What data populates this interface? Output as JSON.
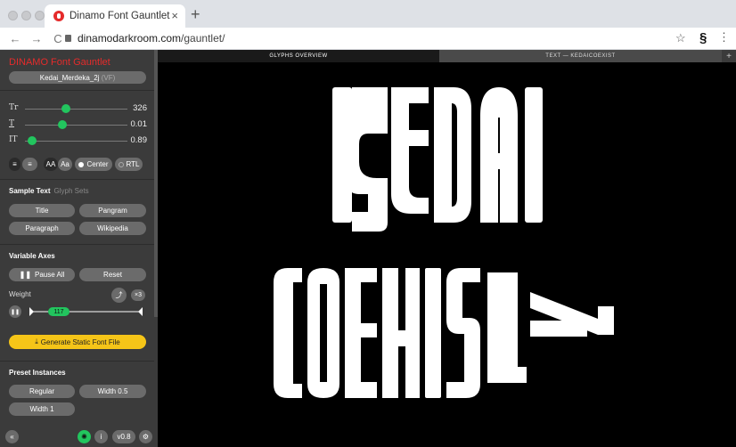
{
  "browser": {
    "tab_title": "Dinamo Font Gauntlet",
    "url_host": "dinamodarkroom.com",
    "url_path": "/gauntlet/",
    "new_tab": "+",
    "close": "×",
    "back": "←",
    "forward": "→",
    "reload": "C",
    "star": "☆",
    "extension": "§",
    "menu": "⋮"
  },
  "sidebar": {
    "app_title": "DINAMO Font Gauntlet",
    "font_name": "Kedai_Merdeka_2j",
    "font_suffix": "(VF)",
    "sliders": [
      {
        "label": "Tr",
        "value": "326",
        "fraction": 0.39
      },
      {
        "label": "T",
        "value": "0.01",
        "fraction": 0.35
      },
      {
        "label": "IT",
        "value": "0.89",
        "fraction": 0.0
      }
    ],
    "align_left": "≡",
    "align_right": "≡",
    "case_upper": "AA",
    "case_mixed": "Aa",
    "center_label": "Center",
    "rtl_label": "RTL",
    "sample_text_heading": "Sample Text",
    "glyph_sets_heading": "Glyph Sets",
    "sample_buttons": [
      "Title",
      "Pangram",
      "Paragraph",
      "Wikipedia"
    ],
    "variable_axes_heading": "Variable Axes",
    "pause_all": "Pause All",
    "reset": "Reset",
    "weight_label": "Weight",
    "weight_value": "117",
    "weight_fraction": 0.27,
    "speed_label": "×3",
    "generate_label": "Generate Static Font File",
    "preset_heading": "Preset Instances",
    "presets": [
      "Regular",
      "Width 0.5",
      "Width 1"
    ],
    "version": "v0.8",
    "collapse": "«",
    "info": "i"
  },
  "main": {
    "tabs": [
      "GLYPHS OVERVIEW",
      "TEXT — KEDAICOEXIST"
    ],
    "add_tab": "+",
    "specimen_lines": [
      "KEDAI",
      "COEXIST"
    ]
  },
  "colors": {
    "accent_red": "#e52b2b",
    "accent_green": "#22c55e",
    "accent_yellow": "#f5c518",
    "sidebar_bg": "#3b3b3b",
    "canvas_bg": "#000000"
  }
}
